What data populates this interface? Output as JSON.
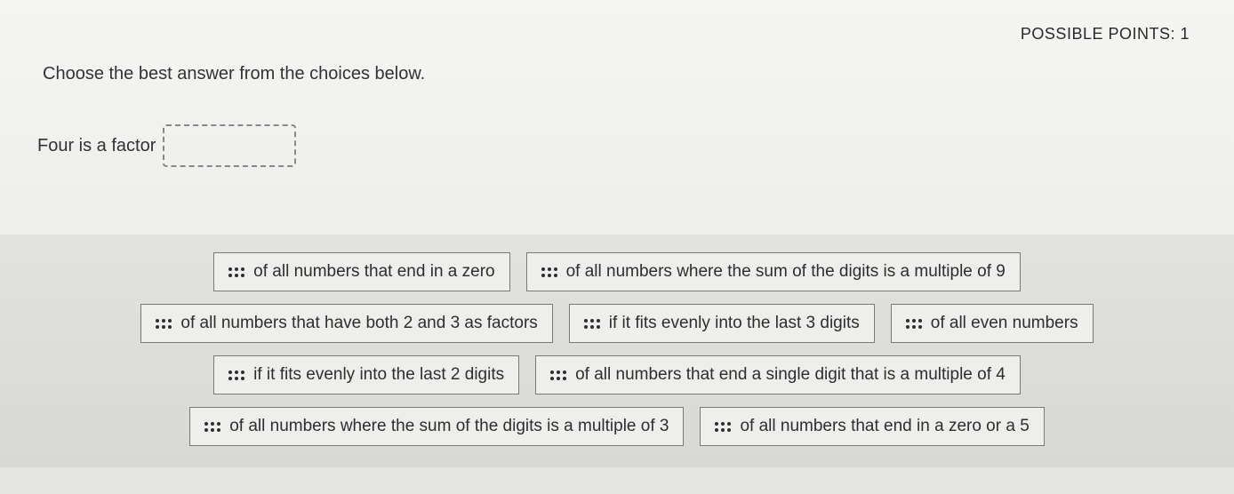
{
  "header": {
    "points_label": "POSSIBLE POINTS: 1"
  },
  "instruction": "Choose the best answer from the choices below.",
  "prompt": {
    "text": "Four is a factor"
  },
  "choices": {
    "row1": [
      "of all numbers that end in a zero",
      "of all numbers where the sum of the digits is a multiple of 9"
    ],
    "row2": [
      "of all numbers that have both 2 and 3 as factors",
      "if it fits evenly into the last 3 digits",
      "of all even numbers"
    ],
    "row3": [
      "if it fits evenly into the last 2 digits",
      "of all numbers that end a single digit that is a multiple of 4"
    ],
    "row4": [
      "of all numbers where the sum of the digits is a multiple of 3",
      "of all numbers that end in a zero or a 5"
    ]
  }
}
